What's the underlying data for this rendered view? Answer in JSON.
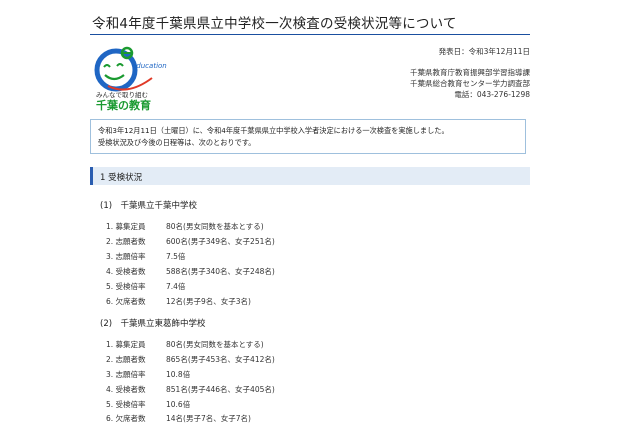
{
  "page": {
    "title": "令和4年度千葉県県立中学校一次検査の受検状況等について"
  },
  "meta": {
    "date": "発表日：令和3年12月11日",
    "dept1": "千葉県教育庁教育振興部学習指導課",
    "dept2": "千葉県総合教育センター学力調査部",
    "phone": "電話：043-276-1298"
  },
  "logo": {
    "caption": "みんなで取り組む",
    "name": "千葉の教育",
    "mark_text": "education",
    "accent_colors": [
      "#1f66c4",
      "#1a9a30",
      "#e03a28"
    ]
  },
  "notice": {
    "line1": "令和3年12月11日（土曜日）に、令和4年度千葉県県立中学校入学者決定における一次検査を実施しました。",
    "line2": "受検状況及び今後の日程等は、次のとおりです。"
  },
  "section": {
    "label": "1 受検状況"
  },
  "schools": [
    {
      "name": "(1)　千葉県立千葉中学校",
      "rows": [
        {
          "k": "1. 募集定員",
          "v": "80名(男女同数を基本とする)"
        },
        {
          "k": "2. 志願者数",
          "v": "600名(男子349名、女子251名)"
        },
        {
          "k": "3. 志願倍率",
          "v": "7.5倍"
        },
        {
          "k": "4. 受検者数",
          "v": "588名(男子340名、女子248名)"
        },
        {
          "k": "5. 受検倍率",
          "v": "7.4倍"
        },
        {
          "k": "6. 欠席者数",
          "v": "12名(男子9名、女子3名)"
        }
      ]
    },
    {
      "name": "(2)　千葉県立東葛飾中学校",
      "rows": [
        {
          "k": "1. 募集定員",
          "v": "80名(男女同数を基本とする)"
        },
        {
          "k": "2. 志願者数",
          "v": "865名(男子453名、女子412名)"
        },
        {
          "k": "3. 志願倍率",
          "v": "10.8倍"
        },
        {
          "k": "4. 受検者数",
          "v": "851名(男子446名、女子405名)"
        },
        {
          "k": "5. 受検倍率",
          "v": "10.6倍"
        },
        {
          "k": "6. 欠席者数",
          "v": "14名(男子7名、女子7名)"
        }
      ]
    }
  ]
}
